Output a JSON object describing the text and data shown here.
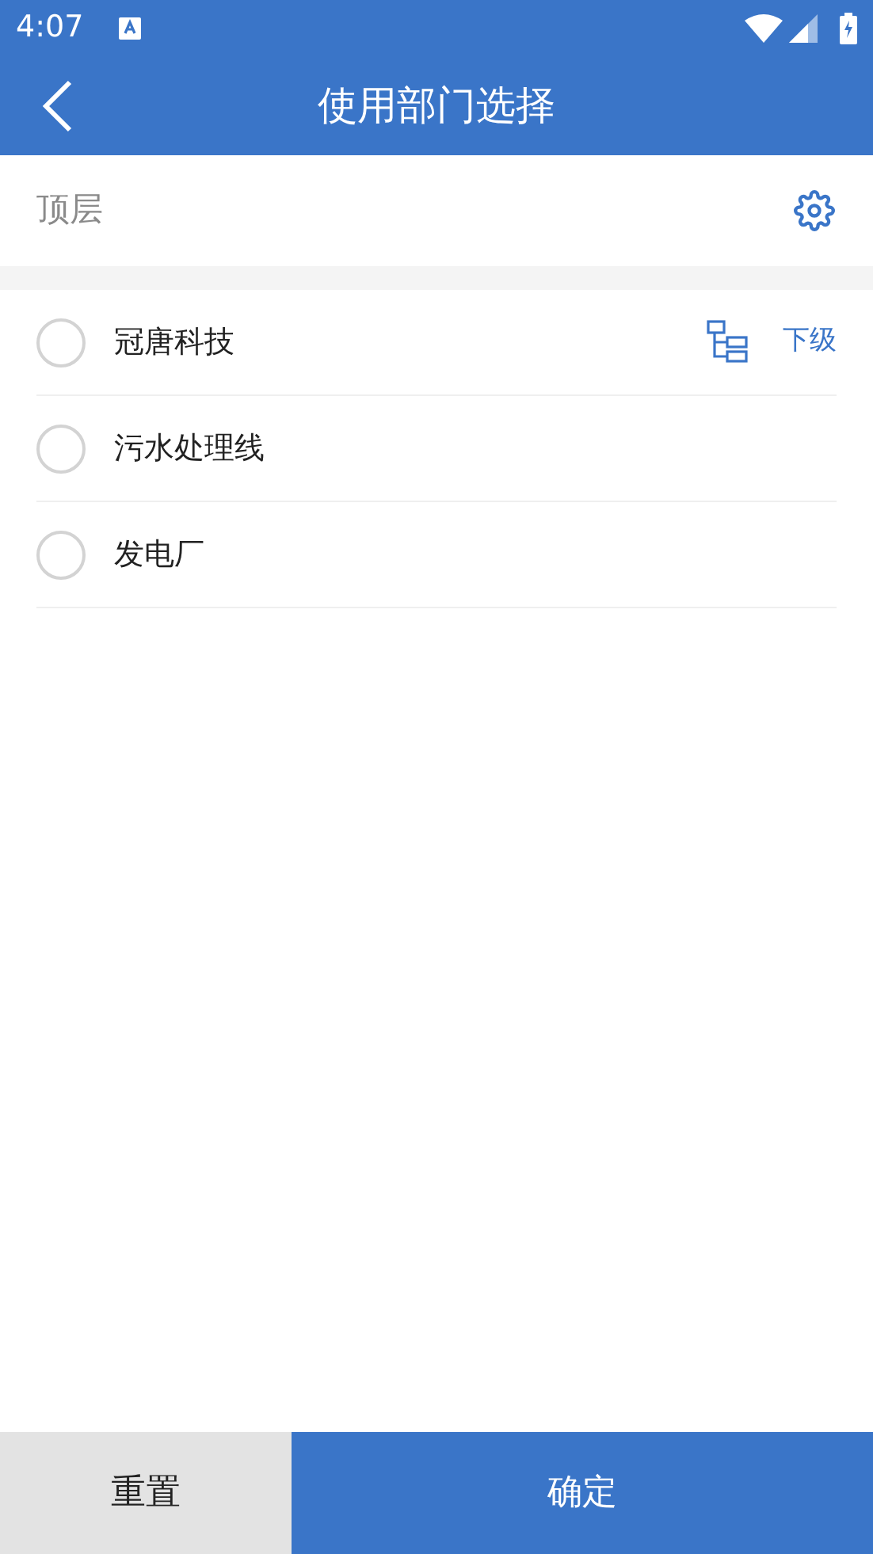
{
  "status_bar": {
    "time": "4:07"
  },
  "header": {
    "title": "使用部门选择"
  },
  "breadcrumb": {
    "label": "顶层"
  },
  "departments": [
    {
      "name": "冠唐科技",
      "selected": false,
      "has_children": true,
      "children_label": "下级"
    },
    {
      "name": "污水处理线",
      "selected": false,
      "has_children": false
    },
    {
      "name": "发电厂",
      "selected": false,
      "has_children": false
    }
  ],
  "buttons": {
    "reset": "重置",
    "confirm": "确定"
  }
}
